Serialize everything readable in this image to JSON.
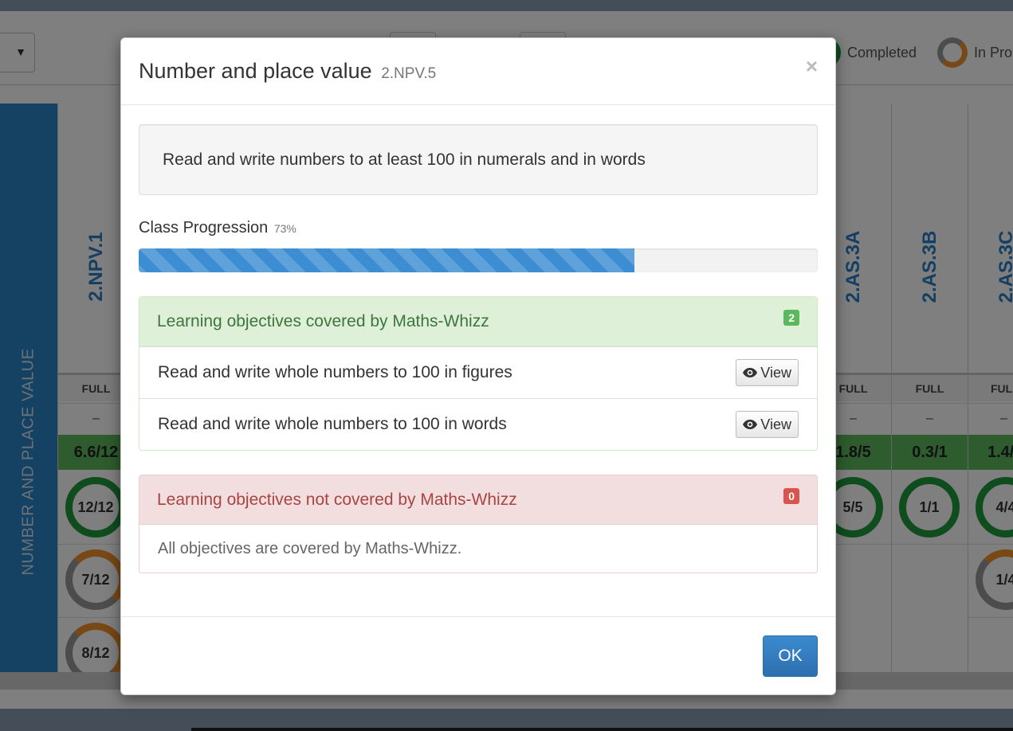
{
  "background": {
    "legend": {
      "completed_label": "Completed",
      "in_progress_label": "In Pro"
    },
    "strand_label": "NUMBER AND PLACE VALUE",
    "columns": [
      {
        "code": "2.NPV.1",
        "coverage": "FULL",
        "dash": "–",
        "score": "6.6/12",
        "rings": [
          "12/12",
          "7/12",
          "8/12"
        ]
      },
      {
        "code": "2.AS.3A",
        "coverage": "FULL",
        "dash": "–",
        "score": "1.8/5",
        "rings": [
          "5/5"
        ]
      },
      {
        "code": "2.AS.3B",
        "coverage": "FULL",
        "dash": "–",
        "score": "0.3/1",
        "rings": [
          "1/1"
        ]
      },
      {
        "code": "2.AS.3C",
        "coverage": "FUL",
        "dash": "–",
        "score": "1.4/",
        "rings": [
          "4/4",
          "1/4"
        ]
      }
    ]
  },
  "modal": {
    "title": "Number and place value",
    "code": "2.NPV.5",
    "close_symbol": "×",
    "objective": "Read and write numbers to at least 100 in numerals and in words",
    "progression": {
      "label": "Class Progression",
      "percent_text": "73%",
      "percent": 73
    },
    "covered": {
      "heading": "Learning objectives covered by Maths-Whizz",
      "count": "2",
      "items": [
        {
          "text": "Read and write whole numbers to 100 in figures",
          "button": "View"
        },
        {
          "text": "Read and write whole numbers to 100 in words",
          "button": "View"
        }
      ]
    },
    "not_covered": {
      "heading": "Learning objectives not covered by Maths-Whizz",
      "count": "0",
      "message": "All objectives are covered by Maths-Whizz."
    },
    "ok_label": "OK"
  },
  "colors": {
    "primary": "#337ab7",
    "success_bg": "#dff0d8",
    "danger_bg": "#f2dede",
    "progress": "#3c8dd1",
    "completed_ring": "#1e9a3c",
    "in_progress_ring": "#f0902a"
  }
}
